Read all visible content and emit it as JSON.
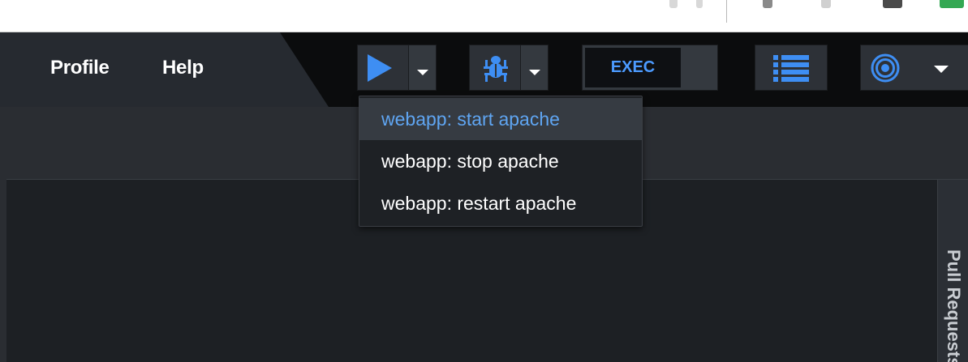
{
  "colors": {
    "accent": "#3e8ef3",
    "menu_bg": "#262a30",
    "topbar_bg": "#0b0c0d",
    "dropdown_active_text": "#5fa5f2"
  },
  "menu": {
    "items": [
      {
        "label": "Profile"
      },
      {
        "label": "Help"
      }
    ]
  },
  "toolbar": {
    "run": {
      "icon": "play-icon",
      "caret_icon": "chevron-down-icon"
    },
    "debug": {
      "icon": "bug-icon",
      "caret_icon": "chevron-down-icon"
    },
    "exec": {
      "label": "EXEC"
    },
    "list": {
      "icon": "list-icon"
    },
    "target": {
      "icon": "target-icon",
      "caret_icon": "chevron-down-icon"
    }
  },
  "run_dropdown": {
    "items": [
      {
        "label": "webapp: start apache",
        "active": true
      },
      {
        "label": "webapp: stop apache",
        "active": false
      },
      {
        "label": "webapp: restart apache",
        "active": false
      }
    ]
  },
  "side_panel": {
    "tab_label": "Pull Requests"
  }
}
